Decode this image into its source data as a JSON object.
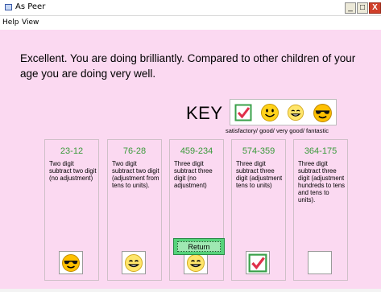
{
  "window": {
    "title": "As Peer",
    "controls": {
      "minimize": "_",
      "maximize": "□",
      "close": "X"
    }
  },
  "menu": [
    "Help",
    "View"
  ],
  "message": "Excellent. You are doing brilliantly. Compared to other children of your age you are doing very well.",
  "key": {
    "label": "KEY",
    "icons": [
      "check-icon",
      "smiley-icon",
      "smiley-icon",
      "sunglasses-smiley-icon"
    ],
    "caption": "satisfactory/ good/ very good/ fantastic"
  },
  "categories": [
    {
      "title": "23-12",
      "description": "Two digit subtract two digit (no adjustment)",
      "rating_icon": "sunglasses-smiley-icon"
    },
    {
      "title": "76-28",
      "description": "Two digit subtract two digit (adjustment from tens to units).",
      "rating_icon": "smiley-icon"
    },
    {
      "title": "459-234",
      "description": "Three digit subtract three digit (no adjustment)",
      "rating_icon": "smiley-icon"
    },
    {
      "title": "574-359",
      "description": "Three digit subtract three digit (adjustment tens to units)",
      "rating_icon": "check-icon"
    },
    {
      "title": "364-175",
      "description": "Three digit subtract three digit (adjustment hundreds to tens and tens to units).",
      "rating_icon": ""
    }
  ],
  "return_button": {
    "label": "Return"
  },
  "colors": {
    "background": "#fbd9f1",
    "category_title": "#3a9a3a",
    "button": "#55d37a",
    "check": "#e0304a",
    "smiley": "#ffd21a"
  }
}
